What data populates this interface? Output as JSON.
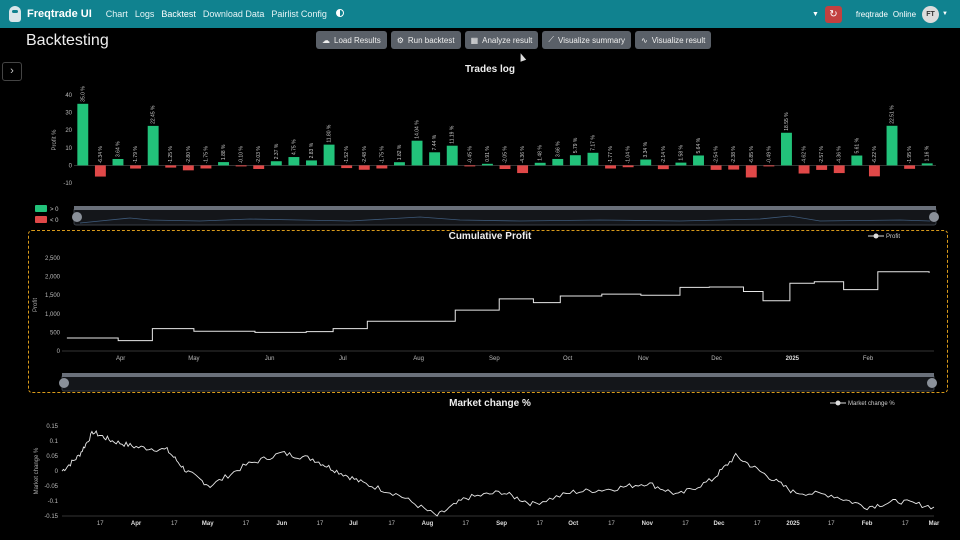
{
  "navbar": {
    "brand": "Freqtrade UI",
    "links": [
      "Chart",
      "Logs",
      "Backtest",
      "Download Data",
      "Pairlist Config"
    ],
    "bot_name": "freqtrade",
    "bot_status": "Online",
    "avatar_initials": "FT",
    "accent_color": "#10828f"
  },
  "page": {
    "title": "Backtesting"
  },
  "toolbar": {
    "buttons": [
      {
        "label": "Load Results",
        "icon": "cloud-download-icon"
      },
      {
        "label": "Run backtest",
        "icon": "run-icon"
      },
      {
        "label": "Analyze result",
        "icon": "table-icon"
      },
      {
        "label": "Visualize summary",
        "icon": "chart-line-icon"
      },
      {
        "label": "Visualize result",
        "icon": "chart-area-icon"
      }
    ]
  },
  "chart_data": [
    {
      "type": "bar",
      "title": "Trades log",
      "ylabel": "Profit %",
      "ylim": [
        -10,
        40
      ],
      "yticks": [
        -10,
        0,
        10,
        20,
        30,
        40
      ],
      "legend": [
        "> 0",
        "< 0"
      ],
      "colors": {
        "positive": "#22c27a",
        "negative": "#e04848"
      },
      "values": [
        35.0,
        -6.34,
        3.64,
        -1.79,
        22.45,
        -1.25,
        -2.8,
        -1.75,
        1.88,
        -0.1,
        -2.03,
        2.37,
        4.75,
        2.83,
        11.8,
        -1.52,
        -2.48,
        -1.75,
        1.82,
        14.04,
        7.44,
        11.19,
        -0.45,
        0.91,
        -2.05,
        -4.36,
        1.48,
        3.66,
        5.79,
        7.17,
        -1.77,
        -1.04,
        3.34,
        -2.14,
        1.58,
        5.64,
        -2.54,
        -2.38,
        -6.85,
        -0.49,
        18.55,
        -4.62,
        -2.57,
        -4.36,
        5.61,
        -6.22,
        22.51,
        -1.95,
        1.16
      ],
      "labels": [
        "35.0 %",
        "-6.34 %",
        "3.64 %",
        "-1.79 %",
        "22.45 %",
        "-1.25 %",
        "-2.80 %",
        "-1.75 %",
        "1.88 %",
        "-0.10 %",
        "-2.03 %",
        "2.37 %",
        "4.75 %",
        "2.83 %",
        "11.80 %",
        "-1.52 %",
        "-2.48 %",
        "-1.75 %",
        "1.82 %",
        "14.04 %",
        "7.44 %",
        "11.19 %",
        "-0.45 %",
        "0.91 %",
        "-2.05 %",
        "-4.36 %",
        "1.48 %",
        "3.66 %",
        "5.79 %",
        "7.17 %",
        "-1.77 %",
        "-1.04 %",
        "3.34 %",
        "-2.14 %",
        "1.58 %",
        "5.64 %",
        "-2.54 %",
        "-2.38 %",
        "-6.85 %",
        "-0.49 %",
        "18.55 %",
        "-4.62 %",
        "-2.57 %",
        "-4.36 %",
        "5.61 %",
        "-6.22 %",
        "22.51 %",
        "-1.95 %",
        "1.16 %"
      ]
    },
    {
      "type": "line",
      "title": "Cumulative Profit",
      "ylabel": "Profit",
      "legend": [
        "Profit"
      ],
      "ylim": [
        0,
        2500
      ],
      "yticks": [
        0,
        500,
        1000,
        1500,
        2000,
        2500
      ],
      "xticks": [
        "Apr",
        "May",
        "Jun",
        "Jul",
        "Aug",
        "Sep",
        "Oct",
        "Nov",
        "Dec",
        "2025",
        "Feb"
      ],
      "x": [
        "2024-03-10",
        "2024-03-31",
        "2024-04-14",
        "2024-05-01",
        "2024-05-26",
        "2024-06-16",
        "2024-06-27",
        "2024-07-11",
        "2024-08-01",
        "2024-08-16",
        "2024-09-03",
        "2024-09-17",
        "2024-09-28",
        "2024-10-15",
        "2024-10-31",
        "2024-11-16",
        "2024-11-28",
        "2024-12-12",
        "2024-12-20",
        "2024-12-31",
        "2025-01-10",
        "2025-01-22",
        "2025-02-05",
        "2025-02-26"
      ],
      "values": [
        350,
        280,
        600,
        530,
        500,
        520,
        600,
        800,
        800,
        1100,
        1400,
        1300,
        1480,
        1530,
        1500,
        1710,
        1720,
        1600,
        1350,
        1820,
        1860,
        1650,
        2130,
        2100
      ]
    },
    {
      "type": "line",
      "title": "Market change %",
      "ylabel": "Market change %",
      "legend": [
        "Market change %"
      ],
      "ylim": [
        -0.15,
        0.15
      ],
      "yticks": [
        -0.15,
        -0.1,
        -0.05,
        0,
        0.05,
        0.1,
        0.15
      ],
      "xticks": [
        "17",
        "Apr",
        "17",
        "May",
        "17",
        "Jun",
        "17",
        "Jul",
        "17",
        "Aug",
        "17",
        "Sep",
        "17",
        "Oct",
        "17",
        "Nov",
        "17",
        "Dec",
        "17",
        "2025",
        "17",
        "Feb",
        "17",
        "Mar"
      ],
      "x": [
        "2024-03-01",
        "2024-03-08",
        "2024-03-14",
        "2024-03-22",
        "2024-04-01",
        "2024-04-14",
        "2024-04-22",
        "2024-05-02",
        "2024-05-17",
        "2024-06-01",
        "2024-06-14",
        "2024-06-24",
        "2024-07-05",
        "2024-07-20",
        "2024-08-05",
        "2024-08-17",
        "2024-09-01",
        "2024-09-14",
        "2024-10-01",
        "2024-10-17",
        "2024-11-01",
        "2024-11-14",
        "2024-11-28",
        "2024-12-08",
        "2024-12-20",
        "2025-01-01",
        "2025-01-17",
        "2025-02-01",
        "2025-02-14",
        "2025-03-01"
      ],
      "values": [
        0.0,
        0.05,
        0.13,
        0.1,
        0.08,
        0.07,
        0.0,
        -0.05,
        0.02,
        0.06,
        0.04,
        0.0,
        -0.04,
        -0.08,
        -0.15,
        -0.09,
        -0.07,
        -0.11,
        -0.07,
        -0.06,
        -0.04,
        -0.08,
        -0.03,
        0.05,
        -0.01,
        -0.07,
        -0.08,
        -0.12,
        -0.1,
        -0.12
      ]
    }
  ]
}
